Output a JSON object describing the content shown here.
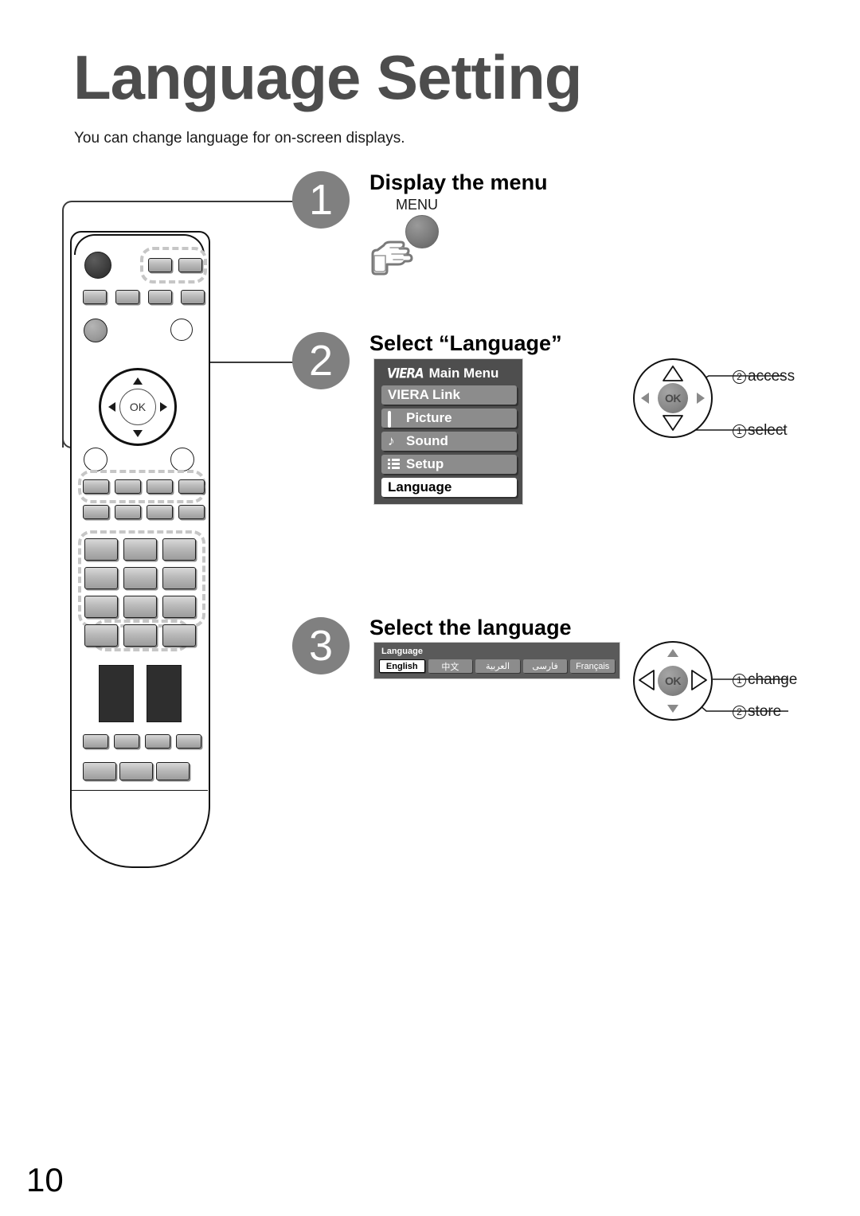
{
  "page": {
    "title": "Language Setting",
    "subtitle": "You can change language for on-screen displays.",
    "number": "10"
  },
  "steps": [
    {
      "number": "1",
      "heading": "Display the menu",
      "remote_button": {
        "label": "MENU",
        "icon": "menu-button-circle",
        "hand_icon": "pointing-hand-icon"
      }
    },
    {
      "number": "2",
      "heading": "Select “Language”",
      "osd": {
        "brand": "VIERA",
        "title": "Main Menu",
        "items": [
          {
            "label": "VIERA Link",
            "icon": null,
            "selected": false
          },
          {
            "label": "Picture",
            "icon": "picture-icon",
            "selected": false
          },
          {
            "label": "Sound",
            "icon": "sound-icon",
            "selected": false
          },
          {
            "label": "Setup",
            "icon": "setup-icon",
            "selected": false
          },
          {
            "label": "Language",
            "icon": null,
            "selected": true
          }
        ]
      },
      "dpad": {
        "highlighted": "up-down",
        "ok_label": "OK",
        "callouts": [
          {
            "num": "②",
            "label": "access",
            "target": "ok-button"
          },
          {
            "num": "①",
            "label": "select",
            "target": "down-arrow"
          }
        ]
      }
    },
    {
      "number": "3",
      "heading": "Select the language",
      "osd": {
        "title": "Language",
        "options": [
          {
            "label": "English",
            "selected": true
          },
          {
            "label": "中文",
            "selected": false
          },
          {
            "label": "العربية",
            "selected": false
          },
          {
            "label": "فارسى",
            "selected": false
          },
          {
            "label": "Français",
            "selected": false
          }
        ]
      },
      "dpad": {
        "highlighted": "left-right",
        "ok_label": "OK",
        "callouts": [
          {
            "num": "①",
            "label": "change",
            "target": "right-arrow"
          },
          {
            "num": "②",
            "label": "store",
            "target": "ok-button"
          }
        ]
      }
    }
  ],
  "colors": {
    "title_gray": "#4d4d4d",
    "step_circle_gray": "#808080",
    "osd_panel_bg": "#4e4e4e",
    "osd_item_bg": "#8c8c8c",
    "osd_selected_bg": "#ffffff",
    "language_panel_bg": "#5a5a5a",
    "dash_highlight": "#c6c6c6"
  }
}
